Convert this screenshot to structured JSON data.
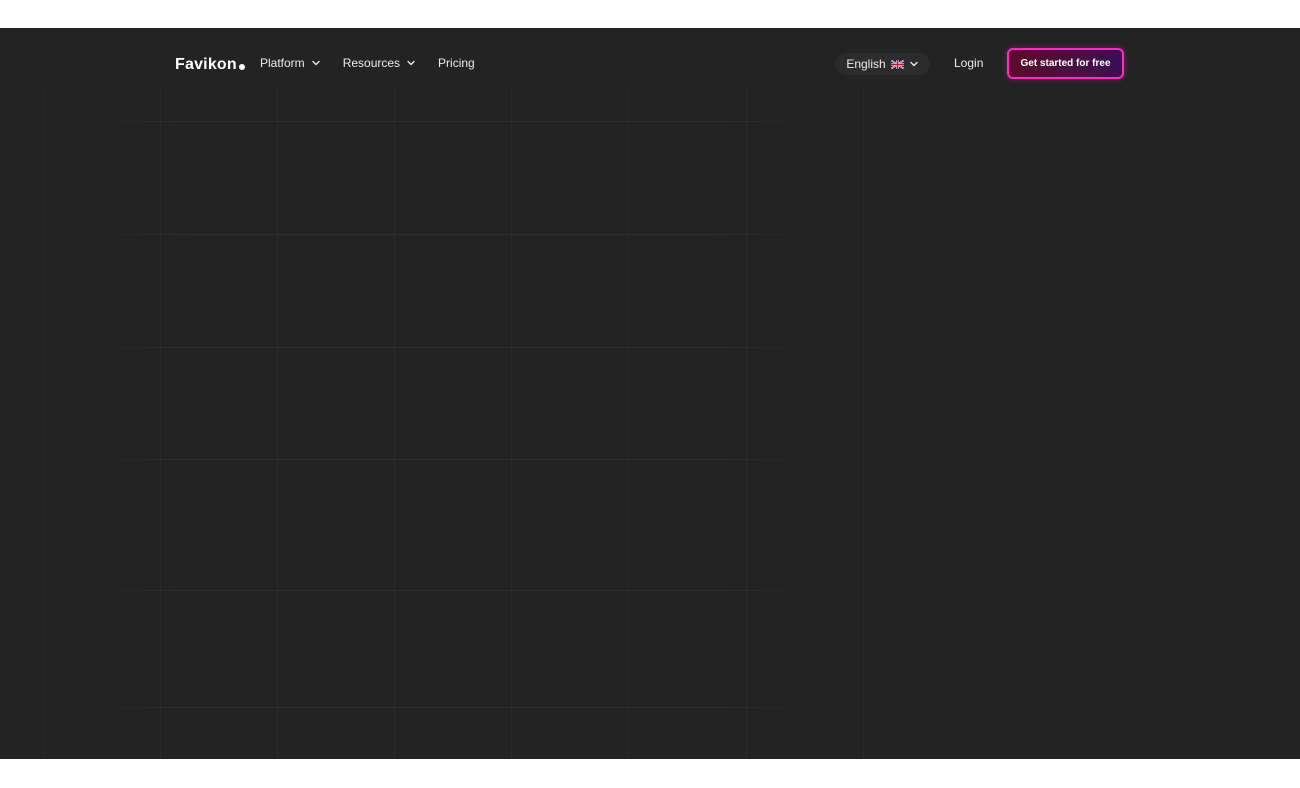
{
  "brand": {
    "name": "Favikon"
  },
  "nav": {
    "items": [
      {
        "label": "Platform",
        "icon": "chevron-down-icon"
      },
      {
        "label": "Resources",
        "icon": "chevron-down-icon"
      },
      {
        "label": "Pricing"
      }
    ],
    "language": {
      "label": "English",
      "flag": "uk-flag-icon",
      "icon": "chevron-down-icon"
    },
    "login_label": "Login",
    "cta_label": "Get started for free"
  },
  "colors": {
    "background": "#232323",
    "cta_border": "#ff2bbe",
    "cta_fill": "#4a1040"
  }
}
